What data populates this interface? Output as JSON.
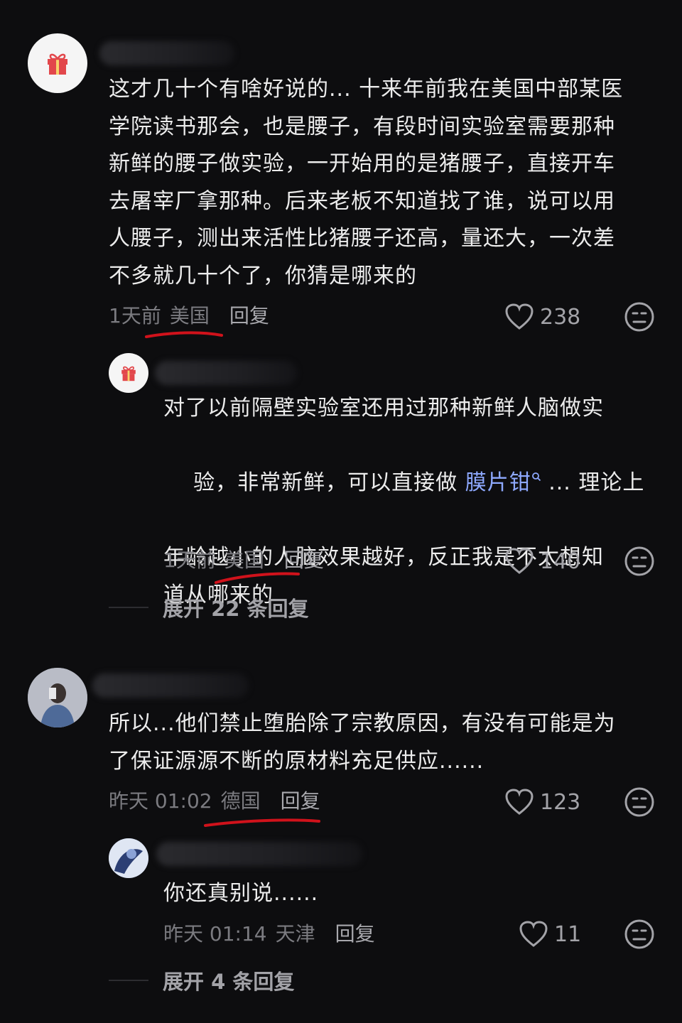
{
  "comments": [
    {
      "avatar_icon": "gift-icon",
      "text_lines": [
        "这才几十个有啥好说的... 十来年前我在美国中部某医",
        "学院读书那会，也是腰子，有段时间实验室需要那种",
        "新鲜的腰子做实验，一开始用的是猪腰子，直接开车",
        "去屠宰厂拿那种。后来老板不知道找了谁，说可以用",
        "人腰子，测出来活性比猪腰子还高，量还大，一次差",
        "不多就几十个了，你猜是哪来的"
      ],
      "time": "1天前",
      "location": "美国",
      "reply_label": "回复",
      "likes": "238"
    },
    {
      "avatar_icon": "gift-icon",
      "text_lines": [
        "对了以前隔壁实验室还用过那种新鲜人脑做实",
        "验，非常新鲜，可以直接做",
        "年龄越小的人脑效果越好，反正我是不太想知",
        "道从哪来的"
      ],
      "link_text": "膜片钳",
      "link_suffix": " ... 理论上",
      "time": "1天前",
      "location": "美国",
      "reply_label": "回复",
      "likes": "140"
    },
    {
      "avatar_icon": "user-photo",
      "text_lines": [
        "所以...他们禁止堕胎除了宗教原因，有没有可能是为",
        "了保证源源不断的原材料充足供应......"
      ],
      "time": "昨天 01:02",
      "location": "德国",
      "reply_label": "回复",
      "likes": "123"
    },
    {
      "avatar_icon": "user-photo",
      "text_lines": [
        "你还真别说......"
      ],
      "time": "昨天 01:14",
      "location": "天津",
      "reply_label": "回复",
      "likes": "11"
    }
  ],
  "expand_1": "展开 22 条回复",
  "expand_2": "展开 4 条回复",
  "colors": {
    "background": "#0d0d0f",
    "annotation_red": "#d0121b",
    "link": "#8ea9ff"
  }
}
